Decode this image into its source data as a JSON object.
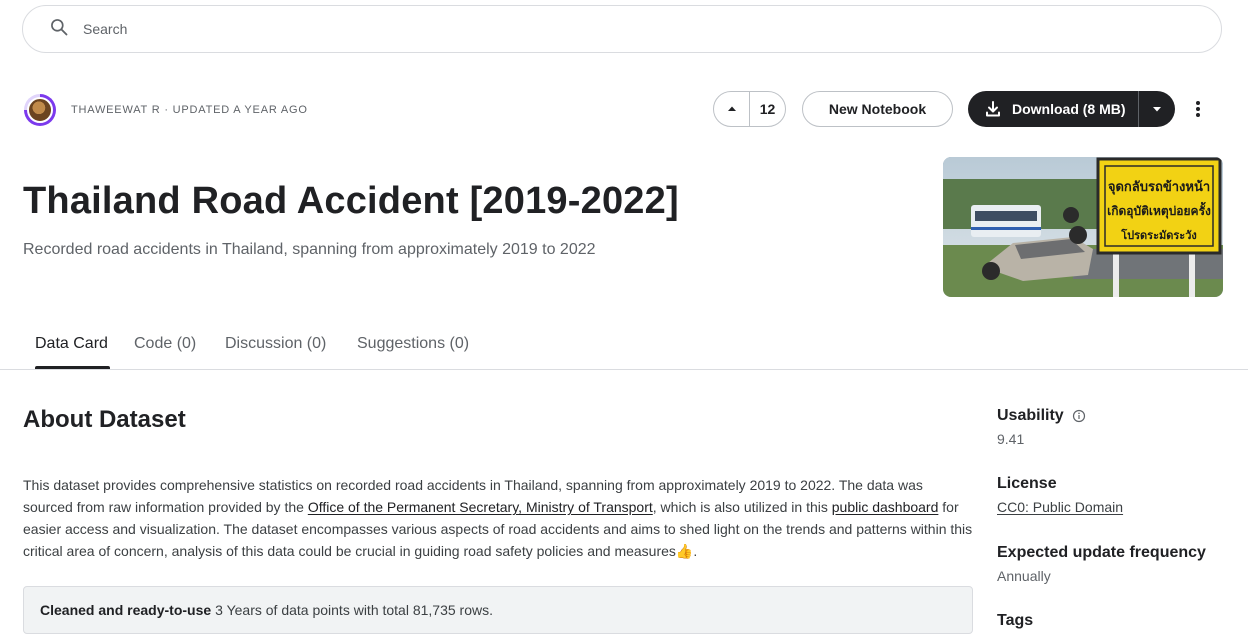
{
  "search": {
    "placeholder": "Search"
  },
  "dataset": {
    "author_line": "THAWEEWAT R · UPDATED A YEAR AGO",
    "vote_count": "12",
    "new_notebook_label": "New Notebook",
    "download_label": "Download (8 MB)",
    "title": "Thailand Road Accident [2019-2022]",
    "subtitle": "Recorded road accidents in Thailand, spanning from approximately 2019 to 2022"
  },
  "tabs": [
    {
      "label": "Data Card",
      "active": true
    },
    {
      "label": "Code (0)",
      "active": false
    },
    {
      "label": "Discussion (0)",
      "active": false
    },
    {
      "label": "Suggestions (0)",
      "active": false
    }
  ],
  "about": {
    "heading": "About Dataset",
    "p1_a": "This dataset provides comprehensive statistics on recorded road accidents in Thailand, spanning from approximately 2019 to 2022. The data was sourced from raw information provided by the ",
    "link1": "Office of the Permanent Secretary, Ministry of Transport",
    "p1_b": ", which is also utilized in this ",
    "link2": "public dashboard",
    "p1_c": " for easier access and visualization. The dataset encompasses various aspects of road accidents and aims to shed light on the trends and patterns within this critical area of concern, analysis of this data could be crucial in guiding road safety policies and measures👍.",
    "callout_bold": "Cleaned and ready-to-use",
    "callout_text": "3 Years of data points with total 81,735 rows."
  },
  "sidebar": {
    "usability_label": "Usability",
    "usability_value": "9.41",
    "license_label": "License",
    "license_value": "CC0: Public Domain",
    "frequency_label": "Expected update frequency",
    "frequency_value": "Annually",
    "tags_label": "Tags"
  },
  "cover_sign": {
    "line1": "จุดกลับรถข้างหน้า",
    "line2": "เกิดอุบัติเหตุบ่อยครั้ง",
    "line3": "โปรดระมัดระวัง"
  },
  "colors": {
    "primary_dark": "#202124",
    "accent_purple": "#7c3aed",
    "muted_text": "#5f6368",
    "border": "#dadce0",
    "sign_yellow": "#f2d214"
  }
}
